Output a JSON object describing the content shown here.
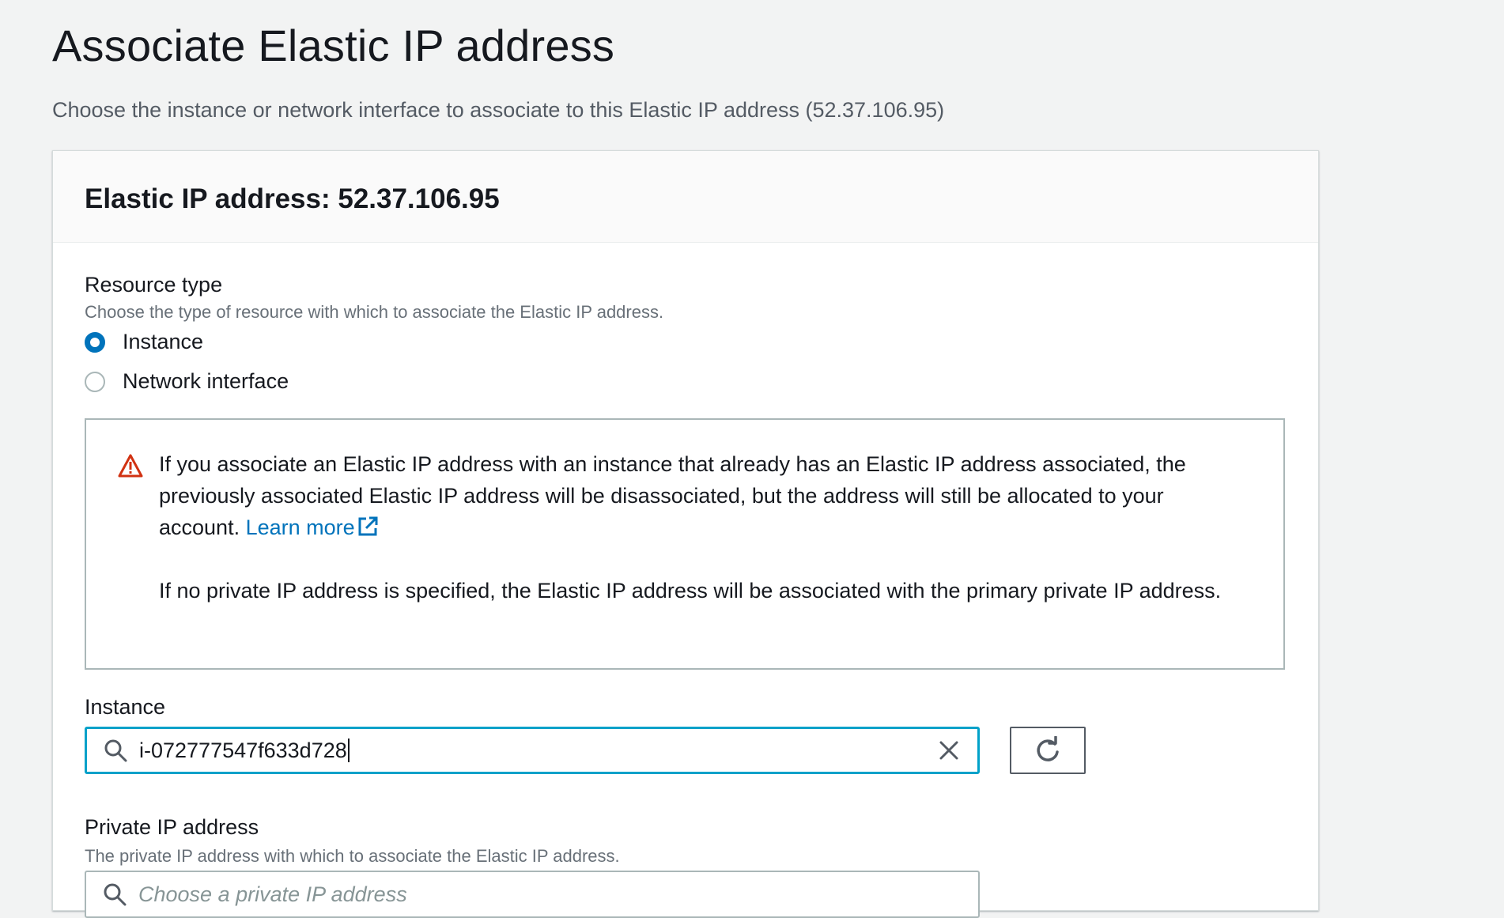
{
  "page": {
    "title": "Associate Elastic IP address",
    "description": "Choose the instance or network interface to associate to this Elastic IP address (52.37.106.95)"
  },
  "panel": {
    "header": "Elastic IP address: 52.37.106.95"
  },
  "resource_type": {
    "label": "Resource type",
    "description": "Choose the type of resource with which to associate the Elastic IP address.",
    "options": [
      {
        "label": "Instance",
        "selected": true
      },
      {
        "label": "Network interface",
        "selected": false
      }
    ]
  },
  "alert": {
    "paragraph1": "If you associate an Elastic IP address with an instance that already has an Elastic IP address associated, the previously associated Elastic IP address will be disassociated, but the address will still be allocated to your account.",
    "link_label": "Learn more",
    "paragraph2": "If no private IP address is specified, the Elastic IP address will be associated with the primary private IP address.",
    "icon": "warning-icon",
    "color": "#d13212"
  },
  "instance": {
    "label": "Instance",
    "value": "i-072777547f633d728"
  },
  "private_ip": {
    "label": "Private IP address",
    "description": "The private IP address with which to associate the Elastic IP address.",
    "placeholder": "Choose a private IP address"
  },
  "colors": {
    "accent": "#0073bb",
    "focus": "#00a1c9",
    "background": "#f2f3f3"
  }
}
